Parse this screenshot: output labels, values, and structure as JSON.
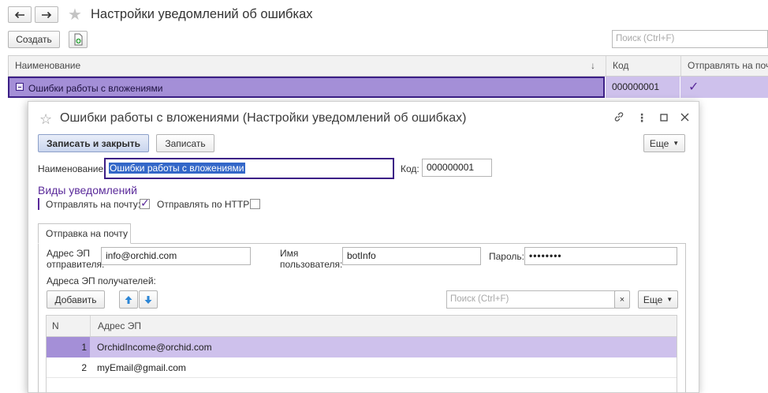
{
  "window": {
    "title": "Настройки уведомлений об ошибках"
  },
  "toolbar": {
    "create_label": "Создать",
    "search_placeholder": "Поиск (Ctrl+F)"
  },
  "list": {
    "columns": [
      "Наименование",
      "Код",
      "Отправлять на почту"
    ],
    "sort_indicator": "↓",
    "rows": [
      {
        "name": "Ошибки работы с вложениями",
        "code": "000000001",
        "send_email": true
      }
    ]
  },
  "dialog": {
    "title": "Ошибки работы с вложениями (Настройки уведомлений об ошибках)",
    "save_close_label": "Записать и закрыть",
    "save_label": "Записать",
    "more_label": "Еще",
    "name_label": "Наименование:",
    "name_value": "Ошибки работы с вложениями",
    "code_label": "Код:",
    "code_value": "000000001",
    "group_title": "Виды уведомлений",
    "send_email_label": "Отправлять на почту:",
    "send_email_checked": true,
    "send_http_label": "Отправлять по HTTP:",
    "send_http_checked": false,
    "tab_label": "Отправка на почту",
    "sender_label_1": "Адрес ЭП",
    "sender_label_2": "отправителя:",
    "sender_value": "info@orchid.com",
    "user_label_1": "Имя",
    "user_label_2": "пользователя:",
    "user_value": "botInfo",
    "password_label": "Пароль:",
    "password_value": "••••••••",
    "recipients_label": "Адреса ЭП получателей:",
    "add_label": "Добавить",
    "search_placeholder": "Поиск (Ctrl+F)",
    "more2_label": "Еще",
    "table": {
      "columns": [
        "N",
        "Адрес ЭП"
      ],
      "rows": [
        {
          "n": "1",
          "email": "OrchidIncome@orchid.com",
          "selected": true
        },
        {
          "n": "2",
          "email": "myEmail@gmail.com",
          "selected": false
        }
      ]
    }
  },
  "colors": {
    "selection": "#a48fd7",
    "selection_light": "#cec1ec",
    "accent_purple": "#5a2a9a",
    "focus_border": "#3c1f86",
    "primary_button": "#c9d5ee"
  },
  "icons": [
    "back-arrow-icon",
    "forward-arrow-icon",
    "favorite-star-icon",
    "copy-add-icon",
    "checkmark-icon",
    "collapse-icon",
    "link-icon",
    "more-vertical-icon",
    "maximize-icon",
    "close-icon",
    "arrow-up-icon",
    "arrow-down-icon",
    "clear-search-icon",
    "dropdown-caret-icon"
  ]
}
